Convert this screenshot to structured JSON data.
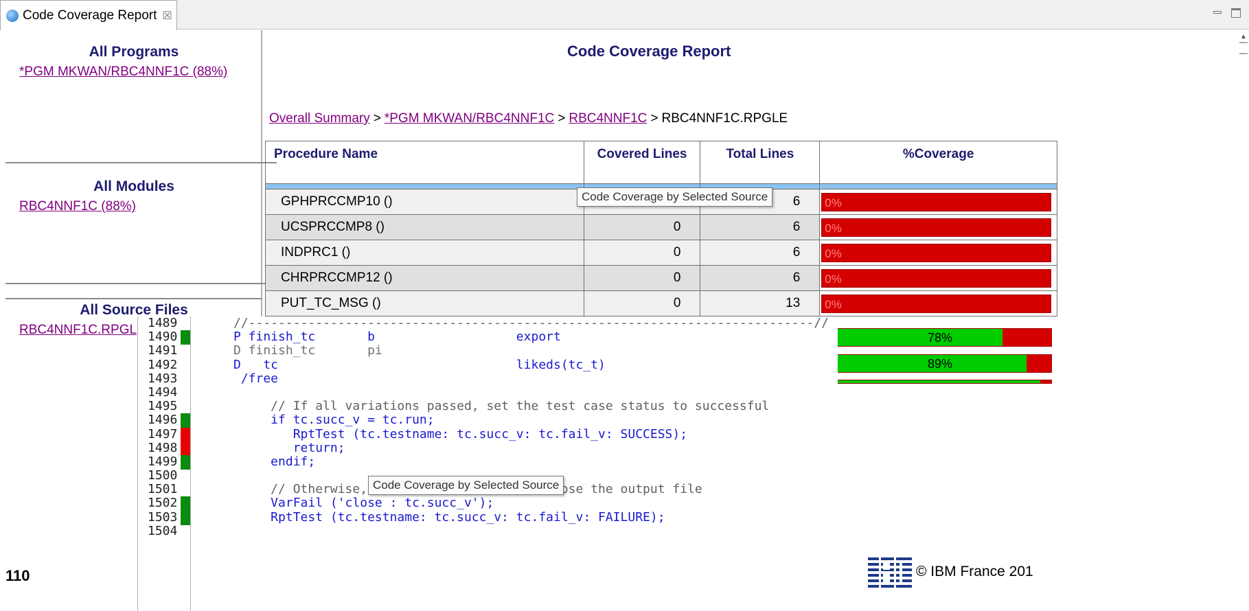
{
  "tab": {
    "title": "Code Coverage Report",
    "close_symbol": "☒"
  },
  "nav": {
    "programs": {
      "heading": "All Programs",
      "items": [
        "*PGM MKWAN/RBC4NNF1C  (88%)"
      ]
    },
    "modules": {
      "heading": "All Modules",
      "items": [
        "RBC4NNF1C  (88%)"
      ]
    },
    "source_files": {
      "heading": "All Source Files",
      "items": [
        "RBC4NNF1C.RPGL"
      ]
    }
  },
  "report": {
    "title": "Code Coverage Report",
    "breadcrumb": {
      "links": [
        "Overall Summary",
        "*PGM MKWAN/RBC4NNF1C",
        "RBC4NNF1C"
      ],
      "separator": ">",
      "current": "RBC4NNF1C.RPGLE"
    },
    "columns": [
      "Procedure Name",
      "Covered Lines",
      "Total Lines",
      "%Coverage"
    ],
    "rows": [
      {
        "name": "GPHPRCCMP10 ()",
        "covered": "0",
        "total": "6",
        "coverage": "0%",
        "coverage_fraction": 0
      },
      {
        "name": "UCSPRCCMP8 ()",
        "covered": "0",
        "total": "6",
        "coverage": "0%",
        "coverage_fraction": 0
      },
      {
        "name": "INDPRC1 ()",
        "covered": "0",
        "total": "6",
        "coverage": "0%",
        "coverage_fraction": 0
      },
      {
        "name": "CHRPRCCMP12 ()",
        "covered": "0",
        "total": "6",
        "coverage": "0%",
        "coverage_fraction": 0
      },
      {
        "name": "PUT_TC_MSG ()",
        "covered": "0",
        "total": "13",
        "coverage": "0%",
        "coverage_fraction": 0
      }
    ],
    "partial_bars": [
      {
        "coverage": "78%",
        "coverage_fraction": 0.78
      },
      {
        "coverage": "89%",
        "coverage_fraction": 0.89
      },
      {
        "coverage": "",
        "coverage_fraction": 0.95
      }
    ]
  },
  "tooltips": {
    "table": "Code Coverage by Selected Source",
    "editor": "Code Coverage by Selected Source"
  },
  "editor": {
    "line_numbers": [
      "1489",
      "1490",
      "1491",
      "1492",
      "1493",
      "1494",
      "1495",
      "1496",
      "1497",
      "1498",
      "1499",
      "1500",
      "1501",
      "1502",
      "1503",
      "1504"
    ],
    "coverage_marks": [
      "none",
      "covered",
      "none",
      "none",
      "none",
      "none",
      "none",
      "covered",
      "uncovered",
      "uncovered",
      "covered",
      "none",
      "none",
      "covered",
      "covered",
      "none"
    ],
    "code_lines": [
      "//----------------------------------------------------------------------------//",
      "P finish_tc       b                   export",
      "D finish_tc       pi",
      "D   tc                                likeds(tc_t)",
      " /free",
      "",
      "     // If all variations passed, set the test case status to successful",
      "     if tc.succ_v = tc.run;",
      "        RptTest (tc.testname: tc.succ_v: tc.fail_v: SUCCESS);",
      "        return;",
      "     endif;",
      "",
      "     // Otherwise, fail the test case and close the output file",
      "     VarFail ('close : tc.succ_v');",
      "     RptTest (tc.testname: tc.succ_v: tc.fail_v: FAILURE);",
      ""
    ]
  },
  "footer": {
    "page_number": "110",
    "copyright": "© IBM France 201"
  },
  "colors": {
    "covered": "#00cc00",
    "uncovered": "#d40000",
    "heading": "#1c1c6e",
    "link": "#800080"
  }
}
